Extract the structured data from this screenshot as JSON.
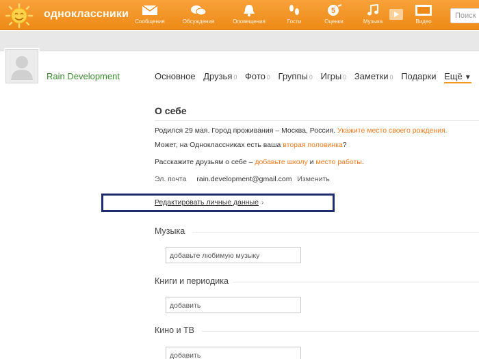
{
  "header": {
    "brand": "одноклассники",
    "nav": [
      {
        "label": "Сообщения",
        "icon": "envelope-icon"
      },
      {
        "label": "Обсуждения",
        "icon": "chat-bubbles-icon"
      },
      {
        "label": "Оповещения",
        "icon": "bell-icon"
      },
      {
        "label": "Гости",
        "icon": "footprints-icon"
      },
      {
        "label": "Оценки",
        "icon": "rating-five-icon"
      },
      {
        "label": "Музыка",
        "icon": "music-note-icon"
      },
      {
        "label": "Видео",
        "icon": "video-icon"
      }
    ],
    "search_placeholder": "Поиск"
  },
  "profile": {
    "name": "Rain Development",
    "tabs": [
      {
        "label": "Основное",
        "count": ""
      },
      {
        "label": "Друзья",
        "count": "0"
      },
      {
        "label": "Фото",
        "count": "0"
      },
      {
        "label": "Группы",
        "count": "0"
      },
      {
        "label": "Игры",
        "count": "0"
      },
      {
        "label": "Заметки",
        "count": "0"
      },
      {
        "label": "Подарки",
        "count": ""
      },
      {
        "label": "Ещё",
        "count": ""
      }
    ]
  },
  "about": {
    "title": "О себе",
    "born_text": "Родился 29 мая. Город проживания – Москва, Россия.",
    "born_link": "Укажите место своего рождения.",
    "half_text1": "Может, на Одноклассниках есть ваша",
    "half_link": "вторая половинка",
    "half_text2": "?",
    "tell_text": "Расскажите друзьям о себе –",
    "school_link": "добавьте школу",
    "and_text": "и",
    "work_link": "место работы",
    "period": ".",
    "email_label": "Эл. почта",
    "email_value": "rain.development@gmail.com",
    "email_change": "Изменить",
    "edit_personal": "Редактировать личные данные",
    "edit_chevron": "›"
  },
  "sections": [
    {
      "title": "Музыка",
      "placeholder": "добавьте любимую музыку"
    },
    {
      "title": "Книги и периодика",
      "placeholder": "добавить"
    },
    {
      "title": "Кино и ТВ",
      "placeholder": "добавить"
    }
  ],
  "colors": {
    "brand_orange": "#ee8a17",
    "link_orange": "#ef7a1d",
    "name_green": "#3a8a2e",
    "highlight_box": "#1e2b6e"
  }
}
